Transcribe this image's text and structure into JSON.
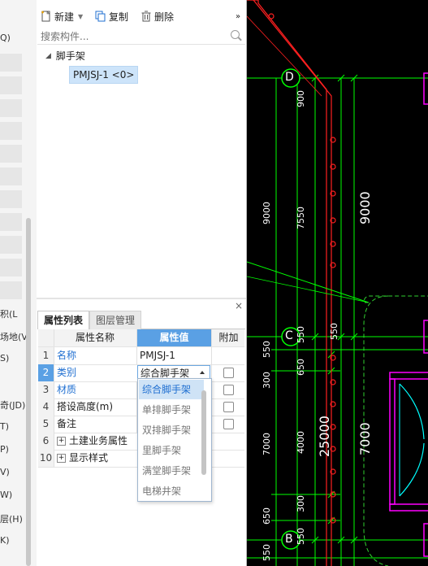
{
  "left_panel": {
    "fragments": [
      "Q)",
      "积(L",
      "场地(V",
      "S)",
      "奇(JD)",
      "T)",
      "P)",
      "V)",
      "W)",
      "层(H)",
      "K)"
    ]
  },
  "toolbar": {
    "new_label": "新建",
    "copy_label": "复制",
    "delete_label": "删除",
    "more_label": "»"
  },
  "search": {
    "placeholder": "搜索构件..."
  },
  "tree": {
    "root_label": "脚手架",
    "child_label": "PMJSJ-1 <0>"
  },
  "tabs": {
    "properties": "属性列表",
    "layers": "图层管理",
    "close": "×"
  },
  "property_table": {
    "headers": {
      "name": "属性名称",
      "value": "属性值",
      "extra": "附加"
    },
    "rows": [
      {
        "num": "1",
        "name": "名称",
        "value": "PMJSJ-1"
      },
      {
        "num": "2",
        "name": "类别",
        "value": "综合脚手架"
      },
      {
        "num": "3",
        "name": "材质",
        "value": ""
      },
      {
        "num": "4",
        "name": "搭设高度(m)",
        "value": ""
      },
      {
        "num": "5",
        "name": "备注",
        "value": ""
      },
      {
        "num": "6",
        "name": "土建业务属性",
        "value": ""
      },
      {
        "num": "10",
        "name": "显示样式",
        "value": ""
      }
    ]
  },
  "dropdown": {
    "options": [
      "综合脚手架",
      "单排脚手架",
      "双排脚手架",
      "里脚手架",
      "满堂脚手架",
      "电梯井架"
    ],
    "selected": "综合脚手架"
  },
  "cad": {
    "axis_labels": [
      "D",
      "C",
      "B"
    ],
    "dimensions": {
      "d900": "900",
      "d9000a": "9000",
      "d7550": "7550",
      "d9000b": "9000",
      "d550a": "550",
      "d650a": "650",
      "d300a": "300",
      "d7000a": "7000",
      "d4000": "4000",
      "d25000": "25000",
      "d7000b": "7000",
      "d300b": "300",
      "d650b": "650",
      "d550b": "550",
      "d550c": "550",
      "d550d": "550",
      "d550e": "550"
    },
    "colors": {
      "background": "#000000",
      "axis": "#00ff00",
      "wall": "#ff2020",
      "window": "#ff00ff",
      "door": "#00ffff",
      "dashed": "#30d030"
    }
  }
}
